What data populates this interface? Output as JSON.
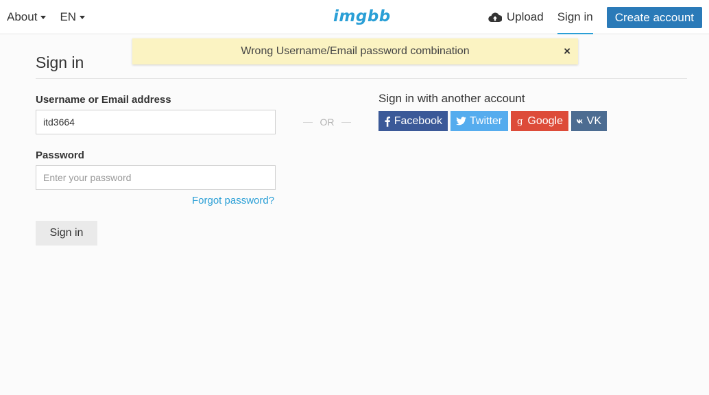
{
  "topbar": {
    "about_label": "About",
    "lang_label": "EN",
    "logo_text": "imgbb",
    "upload_label": "Upload",
    "signin_label": "Sign in",
    "create_account_label": "Create account"
  },
  "alert": {
    "message": "Wrong Username/Email password combination",
    "close_glyph": "×"
  },
  "page": {
    "title": "Sign in"
  },
  "form": {
    "username_label": "Username or Email address",
    "username_value": "itd3664",
    "password_label": "Password",
    "password_placeholder": "Enter your password",
    "forgot_label": "Forgot password?",
    "submit_label": "Sign in"
  },
  "separator": {
    "or_text": "OR"
  },
  "social": {
    "title": "Sign in with another account",
    "buttons": [
      {
        "label": "Facebook",
        "icon": "facebook-icon",
        "color": "#3b5998"
      },
      {
        "label": "Twitter",
        "icon": "twitter-icon",
        "color": "#55acee"
      },
      {
        "label": "Google",
        "icon": "google-icon",
        "color": "#dd4b39"
      },
      {
        "label": "VK",
        "icon": "vk-icon",
        "color": "#4c6c91"
      }
    ]
  },
  "colors": {
    "accent": "#2a9fd6",
    "primary_button": "#2a7ab8",
    "alert_background": "#fbf3c2"
  }
}
